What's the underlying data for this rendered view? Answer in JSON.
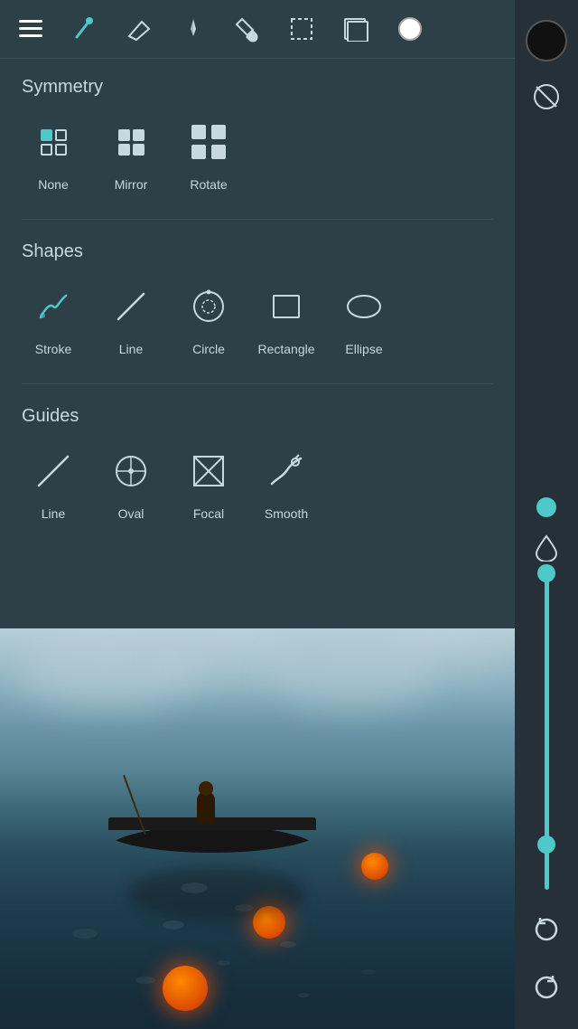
{
  "toolbar": {
    "menu_label": "Menu",
    "brush_label": "Brush",
    "eraser_label": "Eraser",
    "smudge_label": "Smudge",
    "fill_label": "Fill",
    "selection_label": "Selection",
    "layers_label": "Layers",
    "color_label": "Color"
  },
  "symmetry": {
    "title": "Symmetry",
    "items": [
      {
        "id": "none",
        "label": "None"
      },
      {
        "id": "mirror",
        "label": "Mirror"
      },
      {
        "id": "rotate",
        "label": "Rotate"
      }
    ]
  },
  "shapes": {
    "title": "Shapes",
    "items": [
      {
        "id": "stroke",
        "label": "Stroke"
      },
      {
        "id": "line",
        "label": "Line"
      },
      {
        "id": "circle",
        "label": "Circle"
      },
      {
        "id": "rectangle",
        "label": "Rectangle"
      },
      {
        "id": "ellipse",
        "label": "Ellipse"
      }
    ]
  },
  "guides": {
    "title": "Guides",
    "items": [
      {
        "id": "line",
        "label": "Line"
      },
      {
        "id": "oval",
        "label": "Oval"
      },
      {
        "id": "focal",
        "label": "Focal"
      },
      {
        "id": "smooth",
        "label": "Smooth"
      }
    ]
  },
  "sidebar": {
    "color_circle": "black",
    "no_color_icon": "⊘",
    "water_icon": "💧"
  }
}
